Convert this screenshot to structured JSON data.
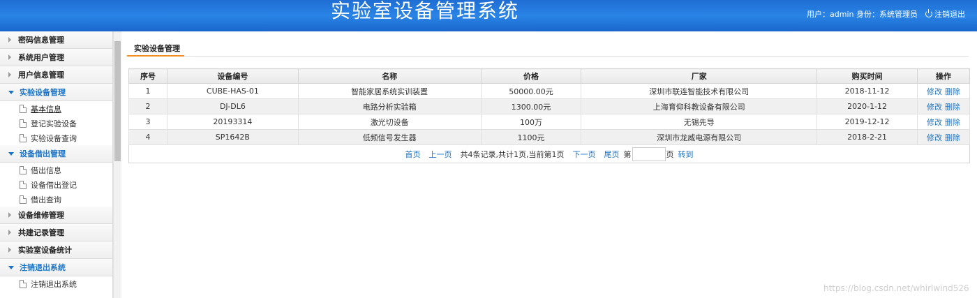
{
  "header": {
    "title": "实验室设备管理系统",
    "user_info": "用户：admin 身份：系统管理员",
    "logout_label": "注销退出"
  },
  "sidebar": {
    "groups": [
      {
        "label": "密码信息管理"
      },
      {
        "label": "系统用户管理"
      },
      {
        "label": "用户信息管理"
      },
      {
        "label": "实验设备管理",
        "items": [
          "基本信息",
          "登记实验设备",
          "实验设备查询"
        ]
      },
      {
        "label": "设备借出管理",
        "items": [
          "借出信息",
          "设备借出登记",
          "借出查询"
        ]
      },
      {
        "label": "设备维修管理"
      },
      {
        "label": "共建记录管理"
      },
      {
        "label": "实验室设备统计"
      },
      {
        "label": "注销退出系统",
        "items": [
          "注销退出系统"
        ]
      }
    ]
  },
  "tab": {
    "label": "实验设备管理"
  },
  "table": {
    "headers": [
      "序号",
      "设备编号",
      "名称",
      "价格",
      "厂家",
      "购买时间",
      "操作"
    ],
    "rows": [
      [
        "1",
        "CUBE-HAS-01",
        "智能家居系统实训装置",
        "50000.00元",
        "深圳市联连智能技术有限公司",
        "2018-11-12"
      ],
      [
        "2",
        "DJ-DL6",
        "电路分析实验箱",
        "1300.00元",
        "上海育仰科教设备有限公司",
        "2020-1-12"
      ],
      [
        "3",
        "20193314",
        "激光切设备",
        "100万",
        "无锡先导",
        "2019-12-12"
      ],
      [
        "4",
        "SP1642B",
        "低频信号发生器",
        "1100元",
        "深圳市龙威电源有限公司",
        "2018-2-21"
      ]
    ],
    "edit_label": "修改",
    "delete_label": "删除"
  },
  "pager": {
    "first": "首页",
    "prev": "上一页",
    "info": "共4条记录,共计1页,当前第1页",
    "next": "下一页",
    "last": "尾页",
    "page_prefix": "第",
    "page_suffix": "页",
    "go": "转到",
    "page_input_value": ""
  },
  "watermark": "https://blog.csdn.net/whirlwind526"
}
